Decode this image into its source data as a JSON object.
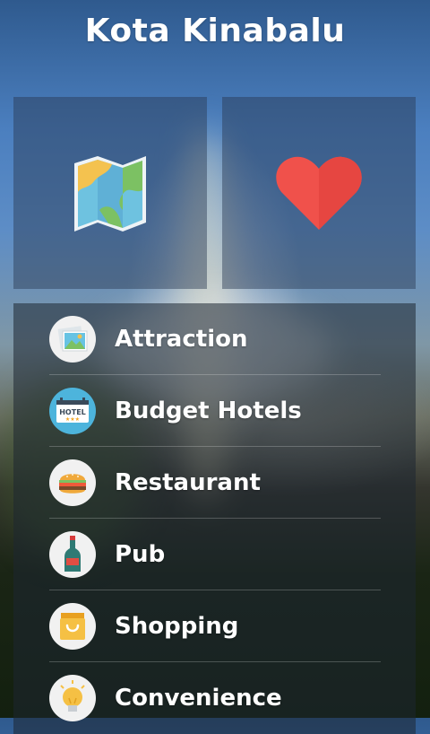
{
  "header": {
    "title": "Kota Kinabalu"
  },
  "tiles": {
    "map_icon": "map-icon",
    "favorites_icon": "heart-icon",
    "heart_color": "#f0514b"
  },
  "menu": {
    "items": [
      {
        "label": "Attraction",
        "icon": "picture-icon"
      },
      {
        "label": "Budget Hotels",
        "icon": "hotel-icon",
        "icon_text": "HOTEL"
      },
      {
        "label": "Restaurant",
        "icon": "burger-icon"
      },
      {
        "label": "Pub",
        "icon": "wine-bottle-icon"
      },
      {
        "label": "Shopping",
        "icon": "shopping-bag-icon"
      },
      {
        "label": "Convenience",
        "icon": "light-bulb-icon"
      }
    ]
  }
}
